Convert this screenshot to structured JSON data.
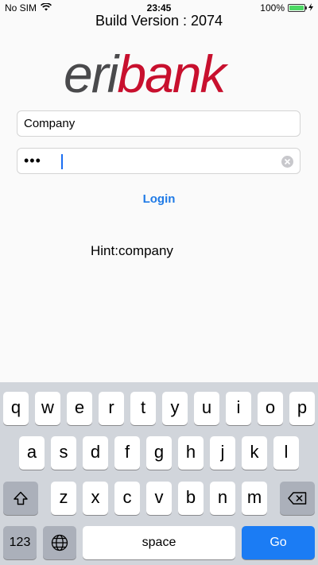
{
  "status_bar": {
    "carrier": "No SIM",
    "time": "23:45",
    "battery": "100%",
    "battery_level": 1.0
  },
  "build_version": "Build Version : 2074",
  "logo": {
    "text_dark": "eri",
    "text_red": "bank",
    "color_dark": "#4a4a4c",
    "color_red": "#c8102e"
  },
  "company_field": {
    "value": "Company"
  },
  "password_field": {
    "masked_value": "•••"
  },
  "login_label": "Login",
  "hint": "Hint:company",
  "keyboard": {
    "row1": [
      "q",
      "w",
      "e",
      "r",
      "t",
      "y",
      "u",
      "i",
      "o",
      "p"
    ],
    "row2": [
      "a",
      "s",
      "d",
      "f",
      "g",
      "h",
      "j",
      "k",
      "l"
    ],
    "row3": [
      "z",
      "x",
      "c",
      "v",
      "b",
      "n",
      "m"
    ],
    "numbers_label": "123",
    "space_label": "space",
    "go_label": "Go"
  },
  "colors": {
    "accent": "#1f7ae6",
    "go_key": "#1b7cf4",
    "keyboard_bg": "#d1d5db"
  }
}
